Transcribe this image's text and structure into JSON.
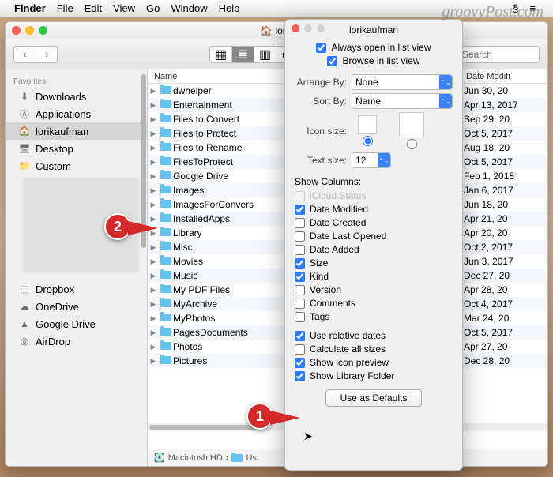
{
  "watermark": "groovyPost.com",
  "menubar": {
    "app": "Finder",
    "items": [
      "File",
      "Edit",
      "View",
      "Go",
      "Window",
      "Help"
    ]
  },
  "window": {
    "title": "lorik"
  },
  "toolbar": {
    "search_placeholder": "Search"
  },
  "sidebar": {
    "section_fav": "Favorites",
    "items": [
      {
        "icon": "download",
        "label": "Downloads"
      },
      {
        "icon": "apps",
        "label": "Applications"
      },
      {
        "icon": "home",
        "label": "lorikaufman",
        "selected": true
      },
      {
        "icon": "desktop",
        "label": "Desktop"
      },
      {
        "icon": "folder",
        "label": "Custom"
      }
    ],
    "items2": [
      {
        "icon": "dropbox",
        "label": "Dropbox"
      },
      {
        "icon": "onedrive",
        "label": "OneDrive"
      },
      {
        "icon": "gdrive",
        "label": "Google Drive"
      },
      {
        "icon": "airdrop",
        "label": "AirDrop"
      }
    ]
  },
  "columns": {
    "name": "Name",
    "date": "Date Modifi"
  },
  "files": [
    {
      "name": "dwhelper",
      "date": "Jun 30, 20"
    },
    {
      "name": "Entertainment",
      "date": "Apr 13, 2017"
    },
    {
      "name": "Files to Convert",
      "date": "Sep 29, 20"
    },
    {
      "name": "Files to Protect",
      "date": "Oct 5, 2017"
    },
    {
      "name": "Files to Rename",
      "date": "Aug 18, 20"
    },
    {
      "name": "FilesToProtect",
      "date": "Oct 5, 2017"
    },
    {
      "name": "Google Drive",
      "date": "Feb 1, 2018"
    },
    {
      "name": "Images",
      "date": "Jan 6, 2017"
    },
    {
      "name": "ImagesForConvers",
      "date": "Jun 18, 20"
    },
    {
      "name": "InstalledApps",
      "date": "Apr 21, 20"
    },
    {
      "name": "Library",
      "date": "Apr 20, 20"
    },
    {
      "name": "Misc",
      "date": "Oct 2, 2017"
    },
    {
      "name": "Movies",
      "date": "Jun 3, 2017"
    },
    {
      "name": "Music",
      "date": "Dec 27, 20"
    },
    {
      "name": "My PDF Files",
      "date": "Apr 28, 20"
    },
    {
      "name": "MyArchive",
      "date": "Oct 4, 2017"
    },
    {
      "name": "MyPhotos",
      "date": "Mar 24, 20"
    },
    {
      "name": "PagesDocuments",
      "date": "Oct 5, 2017"
    },
    {
      "name": "Photos",
      "date": "Apr 27, 20"
    },
    {
      "name": "Pictures",
      "date": "Dec 28, 20"
    }
  ],
  "pathbar": {
    "disk": "Macintosh HD",
    "next": "Us"
  },
  "popover": {
    "title": "lorikaufman",
    "always_open": "Always open in list view",
    "browse_list": "Browse in list view",
    "arrange_by": "Arrange By:",
    "arrange_val": "None",
    "sort_by": "Sort By:",
    "sort_val": "Name",
    "icon_size": "Icon size:",
    "text_size": "Text size:",
    "text_size_val": "12",
    "show_cols": "Show Columns:",
    "cols": [
      {
        "label": "iCloud Status",
        "checked": false,
        "disabled": true
      },
      {
        "label": "Date Modified",
        "checked": true
      },
      {
        "label": "Date Created",
        "checked": false
      },
      {
        "label": "Date Last Opened",
        "checked": false
      },
      {
        "label": "Date Added",
        "checked": false
      },
      {
        "label": "Size",
        "checked": true
      },
      {
        "label": "Kind",
        "checked": true
      },
      {
        "label": "Version",
        "checked": false
      },
      {
        "label": "Comments",
        "checked": false
      },
      {
        "label": "Tags",
        "checked": false
      }
    ],
    "opts": [
      {
        "label": "Use relative dates",
        "checked": true
      },
      {
        "label": "Calculate all sizes",
        "checked": false
      },
      {
        "label": "Show icon preview",
        "checked": true
      },
      {
        "label": "Show Library Folder",
        "checked": true
      }
    ],
    "defaults_btn": "Use as Defaults"
  },
  "callouts": {
    "one": "1",
    "two": "2"
  }
}
